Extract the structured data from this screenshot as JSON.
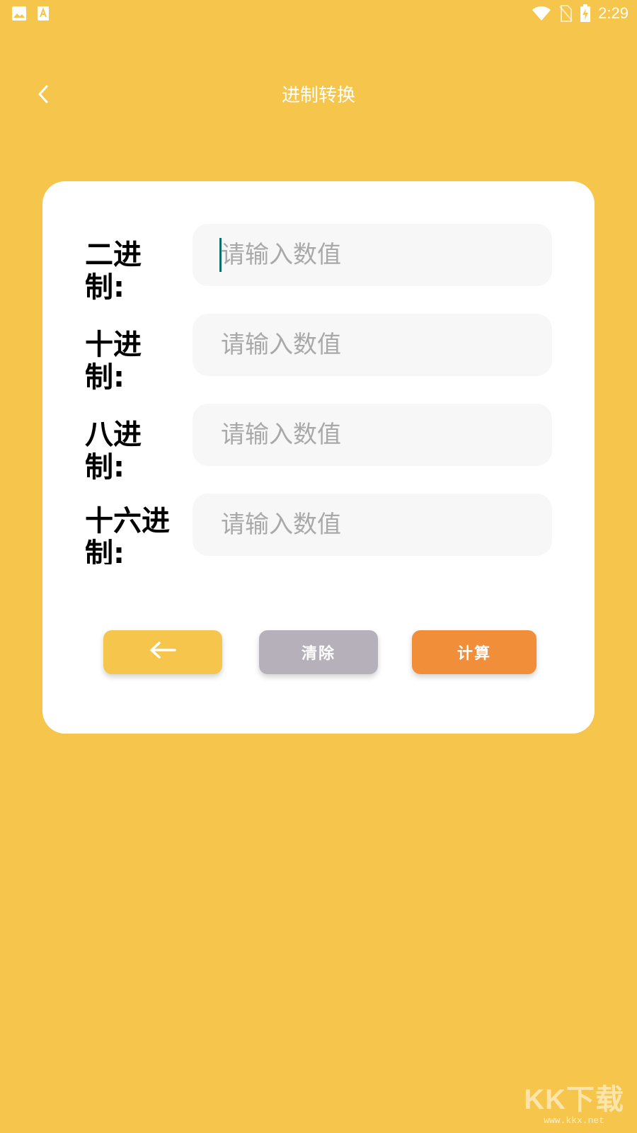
{
  "status_bar": {
    "time": "2:29",
    "left_icons": [
      "image-icon",
      "font-icon"
    ],
    "right_icons": [
      "wifi-icon",
      "no-sim-icon",
      "battery-charging-icon"
    ]
  },
  "nav": {
    "title": "进制转换",
    "back_icon": "chevron-left-icon"
  },
  "form": {
    "fields": [
      {
        "label": "二进制:",
        "placeholder": "请输入数值",
        "value": ""
      },
      {
        "label": "十进制:",
        "placeholder": "请输入数值",
        "value": ""
      },
      {
        "label": "八进制:",
        "placeholder": "请输入数值",
        "value": ""
      },
      {
        "label": "十六进制:",
        "placeholder": "请输入数值",
        "value": ""
      }
    ]
  },
  "buttons": {
    "back_icon": "arrow-left-icon",
    "clear_label": "清除",
    "calc_label": "计算"
  },
  "watermark": {
    "logo": "KK下载",
    "url": "www.kkx.net"
  },
  "colors": {
    "background": "#F6C54B",
    "card": "#FFFFFF",
    "input_bg": "#F7F7F7",
    "clear_button": "#B6B0BA",
    "calc_button": "#F08E3A",
    "caret": "#0E6E6E"
  }
}
